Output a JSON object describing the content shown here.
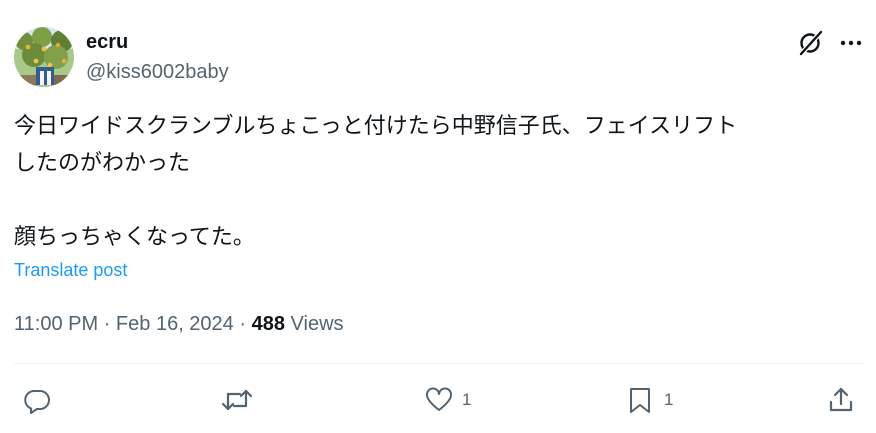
{
  "author": {
    "name": "ecru",
    "handle": "@kiss6002baby"
  },
  "header": {
    "grok_icon": "grok-icon",
    "more_icon": "more-icon"
  },
  "post": {
    "lines": [
      "今日ワイドスクランブルちょこっと付けたら中野信子氏、フェイスリフト",
      "したのがわかった",
      "",
      "顔ちっちゃくなってた。"
    ],
    "translate_label": "Translate post"
  },
  "meta": {
    "time": "11:00 PM",
    "separator": "·",
    "date": "Feb 16, 2024",
    "views_count": "488",
    "views_label": "Views"
  },
  "actions": {
    "reply_icon": "reply-icon",
    "retweet_icon": "retweet-icon",
    "like_icon": "heart-icon",
    "like_count": "1",
    "bookmark_icon": "bookmark-icon",
    "bookmark_count": "1",
    "share_icon": "share-icon"
  },
  "colors": {
    "text": "#0f1419",
    "secondary": "#536471",
    "link": "#1d9bf0",
    "icon": "#536471",
    "divider": "#eff3f4"
  }
}
